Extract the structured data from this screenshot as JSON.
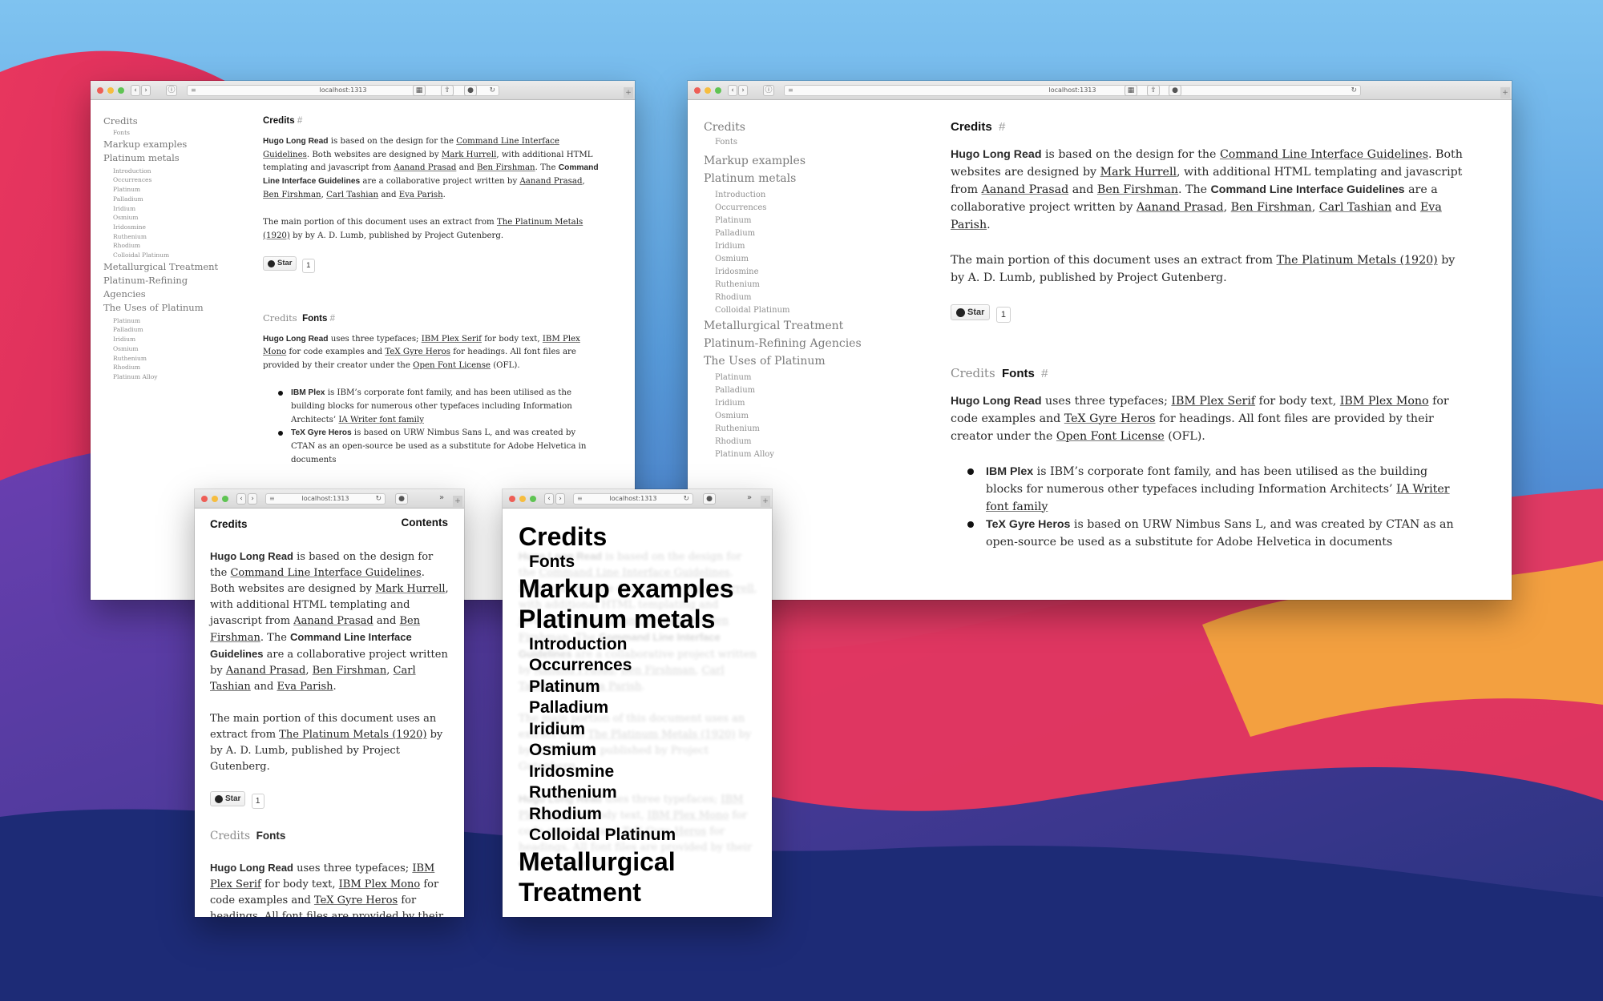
{
  "browser": {
    "address": "localhost:1313"
  },
  "nav": {
    "credits": "Credits",
    "fonts": "Fonts",
    "markup": "Markup examples",
    "platinum": "Platinum metals",
    "platinum_subs": [
      "Introduction",
      "Occurrences",
      "Platinum",
      "Palladium",
      "Iridium",
      "Osmium",
      "Iridosmine",
      "Ruthenium",
      "Rhodium",
      "Colloidal Platinum"
    ],
    "metallurgical": "Metallurgical Treatment",
    "refining": "Platinum-Refining Agencies",
    "uses": "The Uses of Platinum",
    "uses_subs": [
      "Platinum",
      "Palladium",
      "Iridium",
      "Osmium",
      "Ruthenium",
      "Rhodium",
      "Platinum Alloy"
    ]
  },
  "menu_big": {
    "credits": "Credits",
    "markup": "Markup examples",
    "platinum": "Platinum metals",
    "metallurgical": "Metallurgical Treatment"
  },
  "content": {
    "credits_heading": "Credits",
    "hash": "#",
    "contents_link": "Contents",
    "p1": {
      "brand": "Hugo Long Read",
      "t1": " is based on the design for the ",
      "link_clig": "Command Line Interface Guidelines",
      "t2": ". Both websites are designed by ",
      "link_mark": "Mark Hurrell",
      "t3": ", with additional HTML templating and javascript from ",
      "link_aanand": "Aanand Prasad",
      "t4": " and ",
      "link_ben": "Ben Firshman",
      "t5": ". The ",
      "bold_clig": "Command Line Interface Guidelines",
      "t6": " are a collaborative project written by ",
      "link_aanand2": "Aanand Prasad",
      "sep1": ", ",
      "link_ben2": "Ben Firshman",
      "sep2": ", ",
      "link_carl": "Carl Tashian",
      "t7": " and ",
      "link_eva": "Eva Parish",
      "t8": "."
    },
    "p2": {
      "t1": "The main portion of this document uses an extract from ",
      "link_book": "The Platinum Metals (1920)",
      "t2": " by by A. D. Lumb, published by Project Gutenberg."
    },
    "star": {
      "label": "Star",
      "count": "1"
    },
    "breadcrumb": "Credits",
    "fonts_heading": "Fonts",
    "p3": {
      "brand": "Hugo Long Read",
      "t1": " uses three typefaces; ",
      "link_serif": "IBM Plex Serif",
      "t2": " for body text, ",
      "link_mono": "IBM Plex Mono",
      "t3": " for code examples and ",
      "link_tex": "TeX Gyre Heros",
      "t4": " for headings. All font files are provided by their creator under the ",
      "link_ofl": "Open Font License",
      "t5": " (OFL)."
    },
    "bullets": {
      "b1_bold": "IBM Plex",
      "b1_text": " is IBM’s corporate font family, and has been utilised as the building blocks for numerous other typefaces including Information Architects’ ",
      "b1_link": "IA Writer font family",
      "b2_bold": "TeX Gyre Heros",
      "b2_text": " is based on URW Nimbus Sans L, and was created by CTAN as an open-source be used as a substitute for Adobe Helvetica in documents"
    }
  },
  "colors": {
    "accent_text": "#111111",
    "link_underline": "#777777"
  }
}
